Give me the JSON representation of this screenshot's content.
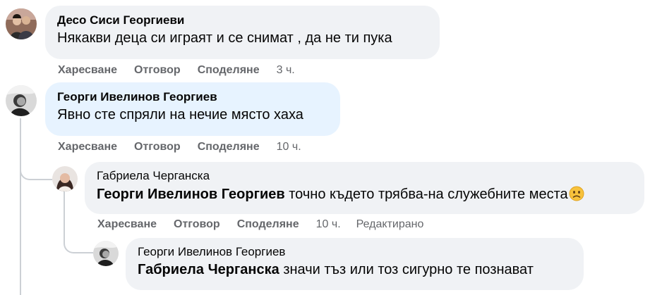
{
  "comments": [
    {
      "author": "Десо Сиси Георгиеви",
      "text": "Някакви деца си играят и се снимат , да не ти пука",
      "actions": {
        "like": "Харесване",
        "reply": "Отговор",
        "share": "Споделяне",
        "time": "3 ч."
      }
    },
    {
      "author": "Георги Ивелинов Георгиев",
      "text": "Явно сте спряли на нечие място хаха",
      "actions": {
        "like": "Харесване",
        "reply": "Отговор",
        "share": "Споделяне",
        "time": "10 ч."
      }
    },
    {
      "author": "Габриела Черганска",
      "mention": "Георги Ивелинов Георгиев",
      "text": " точно където трябва-на служебните места",
      "emoji": "worried-face-emoji",
      "actions": {
        "like": "Харесване",
        "reply": "Отговор",
        "share": "Споделяне",
        "time": "10 ч.",
        "edited": "Редактирано"
      }
    },
    {
      "author": "Георги Ивелинов Георгиев",
      "mention": "Габриела Черганска",
      "text": " значи тъз или тоз сигурно те познават"
    }
  ],
  "colors": {
    "bubble": "#f0f2f5",
    "bubble_highlight": "#e7f3ff",
    "meta": "#65676b",
    "thread_line": "#ccd0d5"
  }
}
